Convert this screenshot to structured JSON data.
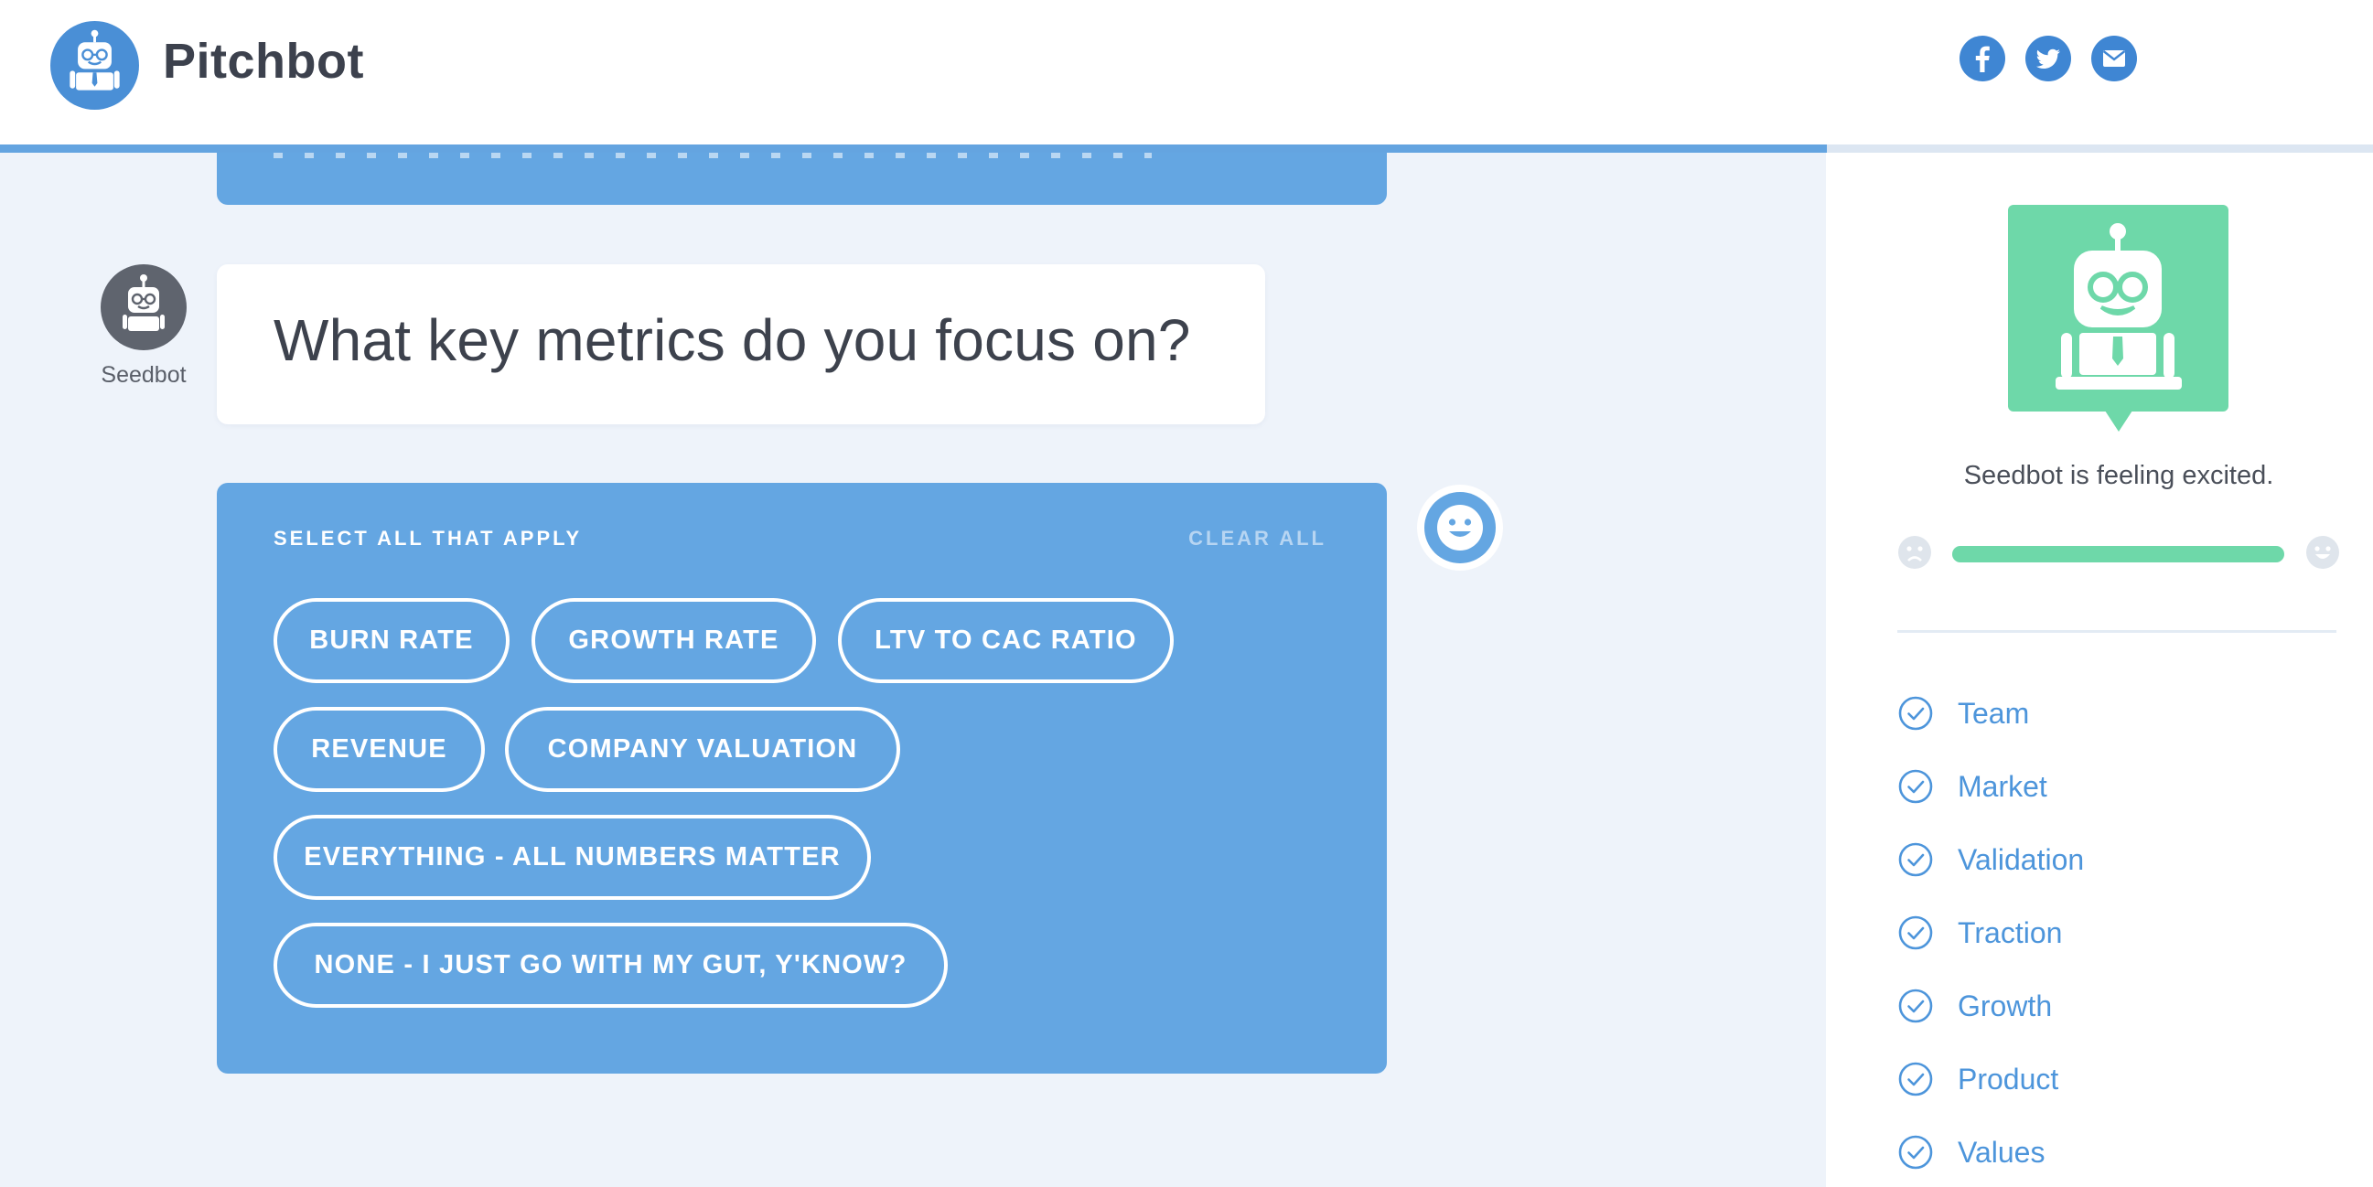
{
  "app": {
    "name": "Pitchbot",
    "logo_icon": "robot-logo-icon"
  },
  "header": {
    "social": [
      {
        "name": "facebook",
        "icon": "facebook-icon"
      },
      {
        "name": "twitter",
        "icon": "twitter-icon"
      },
      {
        "name": "email",
        "icon": "email-icon"
      }
    ],
    "progress_percent": 77
  },
  "conversation": {
    "bot_name": "Seedbot",
    "question": "What key metrics do you focus on?",
    "prompt_label": "SELECT ALL THAT APPLY",
    "clear_all_label": "CLEAR ALL",
    "options": [
      "BURN RATE",
      "GROWTH RATE",
      "LTV TO CAC RATIO",
      "REVENUE",
      "COMPANY VALUATION",
      "EVERYTHING - ALL NUMBERS MATTER",
      "NONE - I JUST GO WITH MY GUT, Y'KNOW?"
    ],
    "user_avatar_icon": "smiley-face-icon"
  },
  "sidebar": {
    "mood_text": "Seedbot is feeling excited.",
    "mood_level_percent": 100,
    "mood_min_icon": "sad-face-icon",
    "mood_max_icon": "happy-face-icon",
    "topics": [
      "Team",
      "Market",
      "Validation",
      "Traction",
      "Growth",
      "Product",
      "Values"
    ],
    "topic_icon": "check-circle-icon"
  },
  "colors": {
    "brand_blue": "#4a8fd6",
    "card_blue": "#64a6e2",
    "mood_green": "#6ed8a9",
    "background": "#eef3fa",
    "topic_blue": "#4d95db"
  }
}
